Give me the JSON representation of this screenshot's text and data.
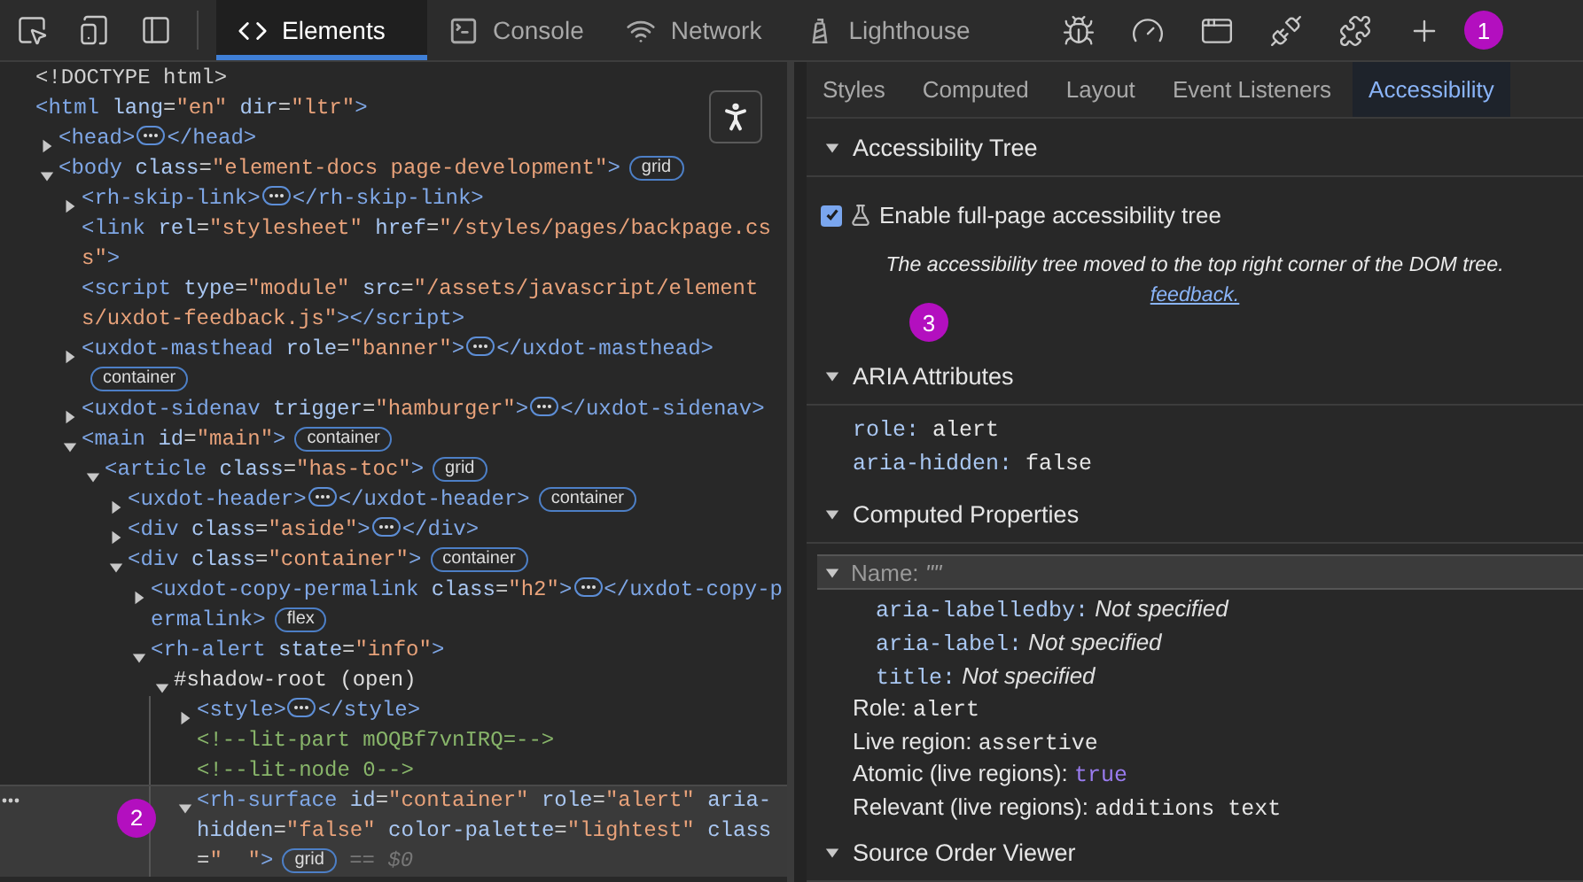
{
  "toolbar": {
    "left_tools": [
      {
        "kind": "inspect"
      },
      {
        "kind": "device"
      },
      {
        "kind": "dock"
      }
    ],
    "tabs": [
      {
        "label": "Elements",
        "kind": "elements",
        "selected": true
      },
      {
        "label": "Console",
        "kind": "console",
        "selected": false
      },
      {
        "label": "Network",
        "kind": "network",
        "selected": false
      },
      {
        "label": "Lighthouse",
        "kind": "lighthouse",
        "selected": false
      }
    ],
    "right_tools": [
      {
        "kind": "bug"
      },
      {
        "kind": "gauge"
      },
      {
        "kind": "window"
      },
      {
        "kind": "plug"
      },
      {
        "kind": "puzzle"
      },
      {
        "kind": "plus"
      }
    ],
    "marker": "1"
  },
  "dom_tree": [
    {
      "selected": false,
      "parts": [
        {
          "kind": "doctype",
          "s": "<!DOCTYPE html>"
        }
      ]
    },
    {
      "selected": false,
      "parts": [
        {
          "kind": "tag",
          "s": "<html"
        },
        {
          "kind": "attr",
          "s": " lang"
        },
        {
          "kind": "p",
          "s": "="
        },
        {
          "kind": "val",
          "s": "\"en\""
        },
        {
          "kind": "attr",
          "s": " dir"
        },
        {
          "kind": "p",
          "s": "="
        },
        {
          "kind": "val",
          "s": "\"ltr\""
        },
        {
          "kind": "tag",
          "s": ">"
        }
      ],
      "children": [
        {
          "selected": false,
          "expanded": false,
          "parts": [
            {
              "kind": "tag",
              "s": "<head>"
            },
            {
              "kind": "more"
            },
            {
              "kind": "tag",
              "s": "</head>"
            }
          ]
        },
        {
          "selected": false,
          "expanded": true,
          "parts": [
            {
              "kind": "tag",
              "s": "<body"
            },
            {
              "kind": "attr",
              "s": " class"
            },
            {
              "kind": "p",
              "s": "="
            },
            {
              "kind": "val",
              "s": "\"element-docs page-development\""
            },
            {
              "kind": "tag",
              "s": ">"
            },
            {
              "kind": "badge",
              "s": "grid"
            }
          ],
          "children": [
            {
              "selected": false,
              "expanded": false,
              "parts": [
                {
                  "kind": "tag",
                  "s": "<rh-skip-link>"
                },
                {
                  "kind": "more"
                },
                {
                  "kind": "tag",
                  "s": "</rh-skip-link>"
                }
              ]
            },
            {
              "selected": false,
              "parts": [
                {
                  "kind": "tag",
                  "s": "<link"
                },
                {
                  "kind": "attr",
                  "s": " rel"
                },
                {
                  "kind": "p",
                  "s": "="
                },
                {
                  "kind": "val",
                  "s": "\"stylesheet\""
                },
                {
                  "kind": "attr",
                  "s": " href"
                },
                {
                  "kind": "p",
                  "s": "="
                },
                {
                  "kind": "val",
                  "s": "\"/styles/pages/backpage.css\""
                },
                {
                  "kind": "tag",
                  "s": ">"
                }
              ]
            },
            {
              "selected": false,
              "parts": [
                {
                  "kind": "tag",
                  "s": "<script"
                },
                {
                  "kind": "attr",
                  "s": " type"
                },
                {
                  "kind": "p",
                  "s": "="
                },
                {
                  "kind": "val",
                  "s": "\"module\""
                },
                {
                  "kind": "attr",
                  "s": " src"
                },
                {
                  "kind": "p",
                  "s": "="
                },
                {
                  "kind": "val",
                  "s": "\"/assets/javascript/elements/uxdot-feedback.js\""
                },
                {
                  "kind": "tag",
                  "s": "></script>"
                }
              ]
            },
            {
              "selected": false,
              "expanded": false,
              "parts": [
                {
                  "kind": "tag",
                  "s": "<uxdot-masthead"
                },
                {
                  "kind": "attr",
                  "s": " role"
                },
                {
                  "kind": "p",
                  "s": "="
                },
                {
                  "kind": "val",
                  "s": "\"banner\""
                },
                {
                  "kind": "tag",
                  "s": ">"
                },
                {
                  "kind": "more"
                },
                {
                  "kind": "tag",
                  "s": "</uxdot-masthead>"
                },
                {
                  "kind": "badge",
                  "s": "container"
                }
              ]
            },
            {
              "selected": false,
              "expanded": false,
              "parts": [
                {
                  "kind": "tag",
                  "s": "<uxdot-sidenav"
                },
                {
                  "kind": "attr",
                  "s": " trigger"
                },
                {
                  "kind": "p",
                  "s": "="
                },
                {
                  "kind": "val",
                  "s": "\"hamburger\""
                },
                {
                  "kind": "tag",
                  "s": ">"
                },
                {
                  "kind": "more"
                },
                {
                  "kind": "tag",
                  "s": "</uxdot-sidenav>"
                }
              ]
            },
            {
              "selected": false,
              "expanded": true,
              "parts": [
                {
                  "kind": "tag",
                  "s": "<main"
                },
                {
                  "kind": "attr",
                  "s": " id"
                },
                {
                  "kind": "p",
                  "s": "="
                },
                {
                  "kind": "val",
                  "s": "\"main\""
                },
                {
                  "kind": "tag",
                  "s": ">"
                },
                {
                  "kind": "badge",
                  "s": "container"
                }
              ],
              "children": [
                {
                  "selected": false,
                  "expanded": true,
                  "parts": [
                    {
                      "kind": "tag",
                      "s": "<article"
                    },
                    {
                      "kind": "attr",
                      "s": " class"
                    },
                    {
                      "kind": "p",
                      "s": "="
                    },
                    {
                      "kind": "val",
                      "s": "\"has-toc\""
                    },
                    {
                      "kind": "tag",
                      "s": ">"
                    },
                    {
                      "kind": "badge",
                      "s": "grid"
                    }
                  ],
                  "children": [
                    {
                      "selected": false,
                      "expanded": false,
                      "parts": [
                        {
                          "kind": "tag",
                          "s": "<uxdot-header>"
                        },
                        {
                          "kind": "more"
                        },
                        {
                          "kind": "tag",
                          "s": "</uxdot-header>"
                        },
                        {
                          "kind": "badge",
                          "s": "container"
                        }
                      ]
                    },
                    {
                      "selected": false,
                      "expanded": false,
                      "parts": [
                        {
                          "kind": "tag",
                          "s": "<div"
                        },
                        {
                          "kind": "attr",
                          "s": " class"
                        },
                        {
                          "kind": "p",
                          "s": "="
                        },
                        {
                          "kind": "val",
                          "s": "\"aside\""
                        },
                        {
                          "kind": "tag",
                          "s": ">"
                        },
                        {
                          "kind": "more"
                        },
                        {
                          "kind": "tag",
                          "s": "</div>"
                        }
                      ]
                    },
                    {
                      "selected": false,
                      "expanded": true,
                      "parts": [
                        {
                          "kind": "tag",
                          "s": "<div"
                        },
                        {
                          "kind": "attr",
                          "s": " class"
                        },
                        {
                          "kind": "p",
                          "s": "="
                        },
                        {
                          "kind": "val",
                          "s": "\"container\""
                        },
                        {
                          "kind": "tag",
                          "s": ">"
                        },
                        {
                          "kind": "badge",
                          "s": "container"
                        }
                      ],
                      "children": [
                        {
                          "selected": false,
                          "expanded": false,
                          "parts": [
                            {
                              "kind": "tag",
                              "s": "<uxdot-copy-permalink"
                            },
                            {
                              "kind": "attr",
                              "s": " class"
                            },
                            {
                              "kind": "p",
                              "s": "="
                            },
                            {
                              "kind": "val",
                              "s": "\"h2\""
                            },
                            {
                              "kind": "tag",
                              "s": ">"
                            },
                            {
                              "kind": "more"
                            },
                            {
                              "kind": "tag",
                              "s": "</uxdot-copy-permalink>"
                            },
                            {
                              "kind": "badge",
                              "s": "flex"
                            }
                          ]
                        },
                        {
                          "selected": false,
                          "expanded": true,
                          "parts": [
                            {
                              "kind": "tag",
                              "s": "<rh-alert"
                            },
                            {
                              "kind": "attr",
                              "s": " state"
                            },
                            {
                              "kind": "p",
                              "s": "="
                            },
                            {
                              "kind": "val",
                              "s": "\"info\""
                            },
                            {
                              "kind": "tag",
                              "s": ">"
                            }
                          ],
                          "children": [
                            {
                              "selected": false,
                              "expanded": true,
                              "parts": [
                                {
                                  "kind": "text",
                                  "s": "#shadow-root (open)"
                                }
                              ],
                              "children": [
                                {
                                  "selected": false,
                                  "expanded": false,
                                  "parts": [
                                    {
                                      "kind": "tag",
                                      "s": "<style>"
                                    },
                                    {
                                      "kind": "more"
                                    },
                                    {
                                      "kind": "tag",
                                      "s": "</style>"
                                    }
                                  ]
                                },
                                {
                                  "selected": false,
                                  "parts": [
                                    {
                                      "kind": "comment",
                                      "s": "<!--lit-part mOQBf7vnIRQ=-->"
                                    }
                                  ]
                                },
                                {
                                  "selected": false,
                                  "parts": [
                                    {
                                      "kind": "comment",
                                      "s": "<!--lit-node 0-->"
                                    }
                                  ]
                                },
                                {
                                  "selected": true,
                                  "expanded": true,
                                  "marker": "2",
                                  "parts": [
                                    {
                                      "kind": "tag",
                                      "s": "<rh-surface"
                                    },
                                    {
                                      "kind": "attr",
                                      "s": " id"
                                    },
                                    {
                                      "kind": "p",
                                      "s": "="
                                    },
                                    {
                                      "kind": "val",
                                      "s": "\"container\""
                                    },
                                    {
                                      "kind": "attr",
                                      "s": " role"
                                    },
                                    {
                                      "kind": "p",
                                      "s": "="
                                    },
                                    {
                                      "kind": "val",
                                      "s": "\"alert\""
                                    },
                                    {
                                      "kind": "attr",
                                      "s": " aria-hidden"
                                    },
                                    {
                                      "kind": "p",
                                      "s": "="
                                    },
                                    {
                                      "kind": "val",
                                      "s": "\"false\""
                                    },
                                    {
                                      "kind": "attr",
                                      "s": " color-palette"
                                    },
                                    {
                                      "kind": "p",
                                      "s": "="
                                    },
                                    {
                                      "kind": "val",
                                      "s": "\"lightest\""
                                    },
                                    {
                                      "kind": "attr",
                                      "s": " class"
                                    },
                                    {
                                      "kind": "p",
                                      "s": "="
                                    },
                                    {
                                      "kind": "val",
                                      "s": "\"  \""
                                    },
                                    {
                                      "kind": "tag",
                                      "s": ">"
                                    },
                                    {
                                      "kind": "badge",
                                      "s": "grid"
                                    },
                                    {
                                      "kind": "ref",
                                      "s": "== $0"
                                    }
                                  ]
                                }
                              ]
                            }
                          ]
                        }
                      ]
                    }
                  ]
                }
              ]
            }
          ]
        }
      ]
    }
  ],
  "side_tabs": [
    {
      "label": "Styles",
      "selected": false
    },
    {
      "label": "Computed",
      "selected": false
    },
    {
      "label": "Layout",
      "selected": false
    },
    {
      "label": "Event Listeners",
      "selected": false
    },
    {
      "label": "Accessibility",
      "selected": true
    }
  ],
  "accessibility_tree": {
    "title": "Accessibility Tree",
    "expanded": true,
    "checkbox": {
      "label": "Enable full-page accessibility tree",
      "checked": true
    },
    "notice": "The accessibility tree moved to the top right corner of the DOM tree.",
    "link": "feedback.",
    "marker": "3"
  },
  "aria_attributes": {
    "title": "ARIA Attributes",
    "expanded": true,
    "items": [
      {
        "name": "role:",
        "value": "alert"
      },
      {
        "name": "aria-hidden:",
        "value": "false"
      }
    ]
  },
  "computed_properties": {
    "title": "Computed Properties",
    "expanded": true,
    "name_row": {
      "label": "Name:",
      "value": "\"\"",
      "expanded": true,
      "selected": true,
      "sources": [
        {
          "name": "aria-labelledby:",
          "value": "Not specified"
        },
        {
          "name": "aria-label:",
          "value": "Not specified"
        },
        {
          "name": "title:",
          "value": "Not specified"
        }
      ]
    },
    "items": [
      {
        "label": "Role:",
        "value": "alert",
        "kind": "mono"
      },
      {
        "label": "Live region:",
        "value": "assertive",
        "kind": "mono"
      },
      {
        "label": "Atomic (live regions):",
        "value": "true",
        "kind": "bool"
      },
      {
        "label": "Relevant (live regions):",
        "value": "additions text",
        "kind": "mono"
      }
    ]
  },
  "source_order": {
    "title": "Source Order Viewer",
    "expanded": true
  }
}
